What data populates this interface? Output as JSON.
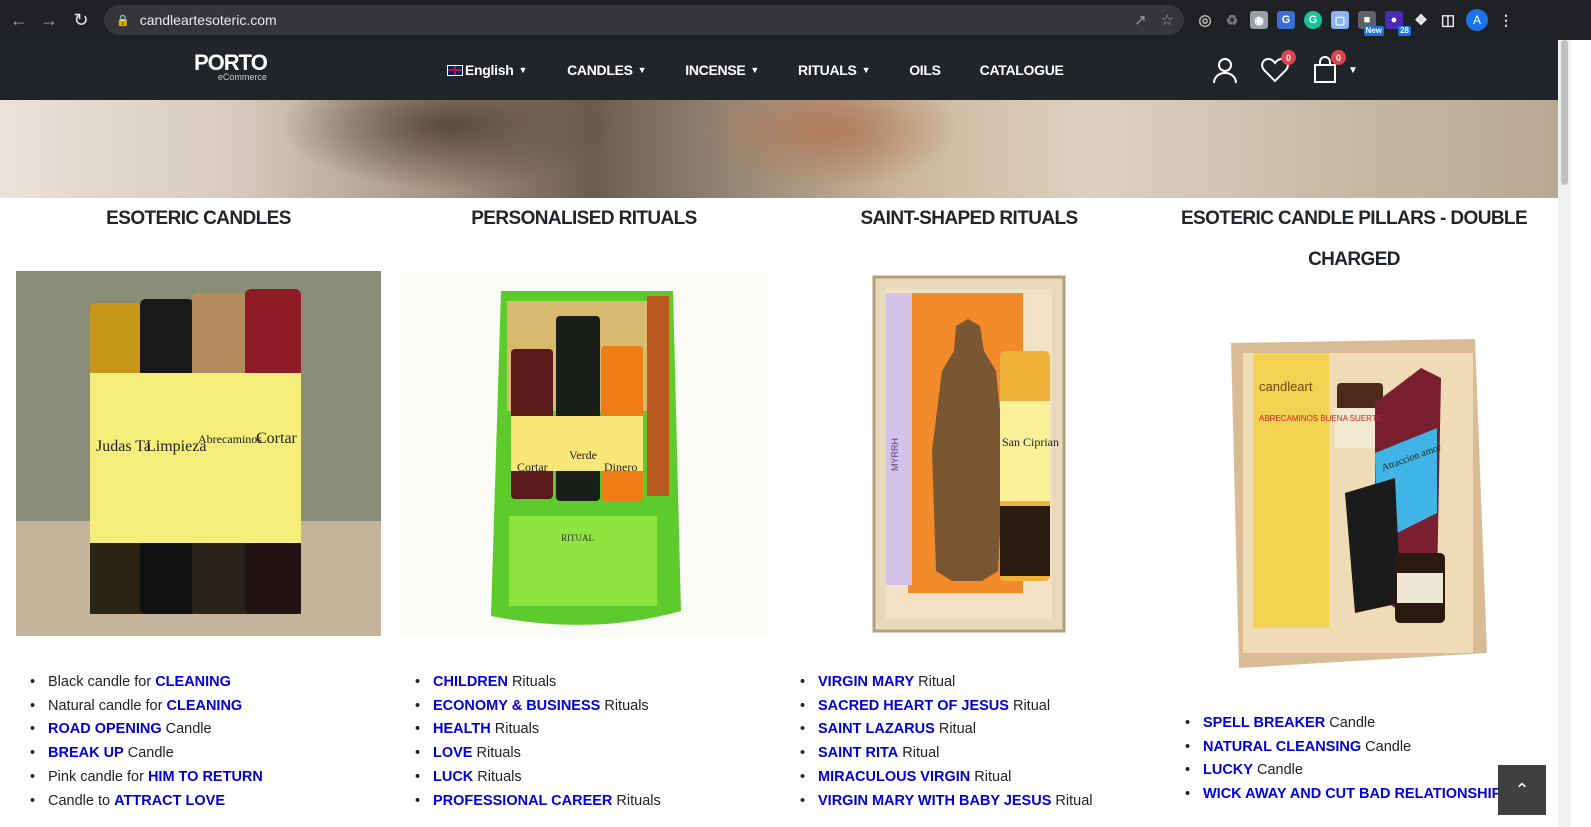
{
  "browser": {
    "url": "candleartesoteric.com",
    "ext_new_label": "New",
    "ext_count": "28",
    "profile_initial": "A"
  },
  "header": {
    "logo_main": "PORTO",
    "logo_sub": "eCommerce",
    "nav": [
      {
        "label": "English",
        "has_dropdown": true
      },
      {
        "label": "CANDLES",
        "has_dropdown": true
      },
      {
        "label": "INCENSE",
        "has_dropdown": true
      },
      {
        "label": "RITUALS",
        "has_dropdown": true
      },
      {
        "label": "OILS",
        "has_dropdown": false
      },
      {
        "label": "CATALOGUE",
        "has_dropdown": false
      }
    ],
    "wishlist_count": "0",
    "cart_count": "0"
  },
  "columns": [
    {
      "title": "ESOTERIC CANDLES",
      "items": [
        {
          "pre": "Black candle for ",
          "link": "CLEANING",
          "post": ""
        },
        {
          "pre": "Natural candle for ",
          "link": "CLEANING",
          "post": ""
        },
        {
          "pre": "",
          "link": "ROAD OPENING",
          "post": " Candle"
        },
        {
          "pre": "",
          "link": "BREAK UP",
          "post": " Candle"
        },
        {
          "pre": "Pink candle for ",
          "link": "HIM TO RETURN",
          "post": ""
        },
        {
          "pre": "Candle to ",
          "link": "ATTRACT LOVE",
          "post": ""
        }
      ]
    },
    {
      "title": "PERSONALISED RITUALS",
      "items": [
        {
          "pre": "",
          "link": "CHILDREN",
          "post": " Rituals"
        },
        {
          "pre": "",
          "link": "ECONOMY & BUSINESS",
          "post": " Rituals"
        },
        {
          "pre": "",
          "link": "HEALTH",
          "post": " Rituals"
        },
        {
          "pre": "",
          "link": "LOVE",
          "post": " Rituals"
        },
        {
          "pre": "",
          "link": "LUCK",
          "post": " Rituals"
        },
        {
          "pre": "",
          "link": "PROFESSIONAL CAREER",
          "post": " Rituals"
        }
      ]
    },
    {
      "title": "SAINT-SHAPED RITUALS",
      "items": [
        {
          "pre": "",
          "link": "VIRGIN MARY",
          "post": " Ritual"
        },
        {
          "pre": "",
          "link": "SACRED HEART OF JESUS",
          "post": " Ritual"
        },
        {
          "pre": "",
          "link": "SAINT LAZARUS",
          "post": " Ritual"
        },
        {
          "pre": "",
          "link": "SAINT RITA",
          "post": " Ritual"
        },
        {
          "pre": "",
          "link": "MIRACULOUS VIRGIN",
          "post": " Ritual"
        },
        {
          "pre": "",
          "link": "VIRGIN MARY WITH BABY JESUS",
          "post": " Ritual"
        }
      ]
    },
    {
      "title": "ESOTERIC CANDLE PILLARS - DOUBLE CHARGED",
      "items": [
        {
          "pre": "",
          "link": "SPELL BREAKER",
          "post": " Candle"
        },
        {
          "pre": "",
          "link": "NATURAL CLEANSING",
          "post": " Candle"
        },
        {
          "pre": "",
          "link": "LUCKY",
          "post": " Candle"
        },
        {
          "pre": "",
          "link": "WICK AWAY AND CUT BAD RELATIONSHIPS",
          "post": ""
        }
      ]
    }
  ],
  "images": {
    "candles": {
      "labels": [
        "Judas Ta",
        "Limpieza",
        "Abrecaminos",
        "Cortar"
      ],
      "colors": [
        "#c9961c",
        "#1a1a1a",
        "#b38b5d",
        "#8e1b25"
      ]
    },
    "ritual_box": {
      "candle_labels": [
        "Cortar",
        "Verde",
        "Dinero"
      ],
      "card_text": "RITUAL Para que una Empresa sea Floreciente y Aumente la Clientela"
    },
    "saint_box": {
      "candle_label": "San Ciprian",
      "incense_label": "MYRRH"
    },
    "pillar_box": {
      "brand": "candleart",
      "label": "ABRECAMINOS BUENA SUERTE",
      "pillar_label": "Atraccion amor"
    }
  },
  "colors": {
    "header_bg": "#212529",
    "link": "#0000dd",
    "badge": "#e2434b"
  }
}
